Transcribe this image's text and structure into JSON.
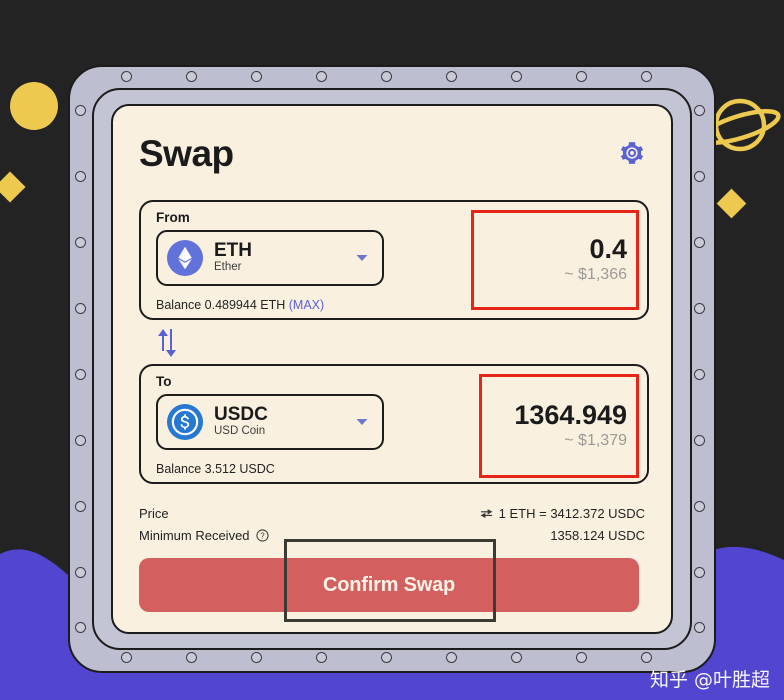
{
  "app": {
    "title": "Swap",
    "settings_icon": "gear-icon"
  },
  "from": {
    "label": "From",
    "token_symbol": "ETH",
    "token_name": "Ether",
    "token_icon": "ethereum-icon",
    "dropdown_icon": "chevron-down-icon",
    "amount": "0.4",
    "amount_usd": "~ $1,366",
    "balance_text": "Balance 0.489944 ETH",
    "max_label": "(MAX)"
  },
  "switch": {
    "icon": "swap-vertical-arrows-icon"
  },
  "to": {
    "label": "To",
    "token_symbol": "USDC",
    "token_name": "USD Coin",
    "token_icon": "usdc-icon",
    "dropdown_icon": "chevron-down-icon",
    "amount": "1364.949",
    "amount_usd": "~ $1,379",
    "balance_text": "Balance 3.512 USDC"
  },
  "info": {
    "price_label": "Price",
    "price_toggle_icon": "swap-horizontal-arrows-icon",
    "price_value": "1 ETH = 3412.372 USDC",
    "minimum_label": "Minimum Received",
    "minimum_help_icon": "question-circle-icon",
    "minimum_value": "1358.124 USDC"
  },
  "action": {
    "confirm_label": "Confirm Swap"
  },
  "watermark": {
    "text": "知乎 @叶胜超"
  },
  "colors": {
    "background": "#232323",
    "wave": "#5245cf",
    "frame": "#bdbecf",
    "card": "#faf0e0",
    "accent": "#5b63d3",
    "confirm": "#d45f5f",
    "annotation_red": "#e62418",
    "annotation_dark": "#3b3b34",
    "decor_yellow": "#edc94f"
  }
}
